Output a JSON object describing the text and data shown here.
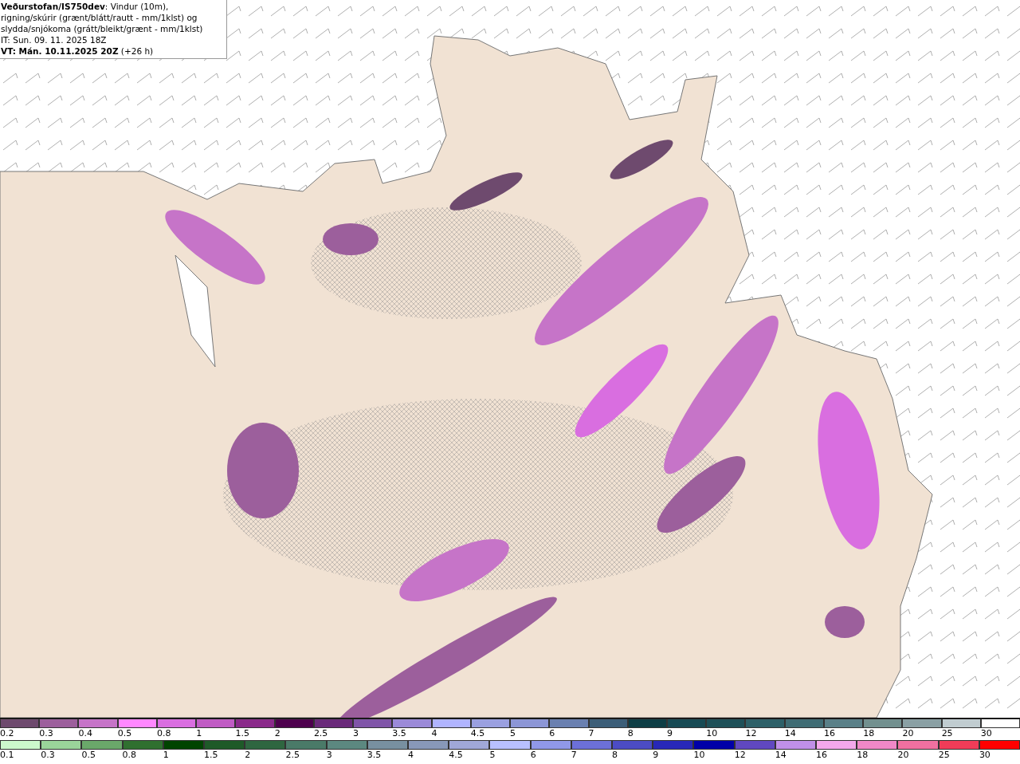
{
  "header": {
    "title": "**Veðurstofan/IS750dev**: Vindur (10m), rigning/skúrir (grænt/blátt/rautt - mm/1klst) og slydda/snjókoma (grátt/bleikt/grænt - mm/1klst)",
    "issue_time": "IT: Sun. 09. 11. 2025 18Z",
    "valid_time": "**VT: Mán. 10.11.2025 20Z** (+26 h)"
  },
  "legends": [
    {
      "items": [
        {
          "label": "0.2",
          "color": "#6e4a6e"
        },
        {
          "label": "0.3",
          "color": "#9c5f9c"
        },
        {
          "label": "0.4",
          "color": "#c674c8"
        },
        {
          "label": "0.5",
          "color": "#ff88ff"
        },
        {
          "label": "0.8",
          "color": "#d96ee0"
        },
        {
          "label": "1",
          "color": "#c05cc4"
        },
        {
          "label": "1.5",
          "color": "#8a2a8a"
        },
        {
          "label": "2",
          "color": "#4d004d"
        },
        {
          "label": "2.5",
          "color": "#6a2a7a"
        },
        {
          "label": "3",
          "color": "#8055a8"
        },
        {
          "label": "3.5",
          "color": "#9b8ad8"
        },
        {
          "label": "4",
          "color": "#b0b4ff"
        },
        {
          "label": "4.5",
          "color": "#9aa0e0"
        },
        {
          "label": "5",
          "color": "#8c96d6"
        },
        {
          "label": "6",
          "color": "#6a80b0"
        },
        {
          "label": "7",
          "color": "#3c5e78"
        },
        {
          "label": "8",
          "color": "#0d3d44"
        },
        {
          "label": "9",
          "color": "#174a54"
        },
        {
          "label": "10",
          "color": "#1e5058"
        },
        {
          "label": "12",
          "color": "#2d6068"
        },
        {
          "label": "14",
          "color": "#3f6c74"
        },
        {
          "label": "16",
          "color": "#5a8088"
        },
        {
          "label": "18",
          "color": "#72908f"
        },
        {
          "label": "20",
          "color": "#8aa0a4"
        },
        {
          "label": "25",
          "color": "#c0ccd0"
        },
        {
          "label": "30",
          "color": "#ffffff"
        }
      ]
    },
    {
      "items": [
        {
          "label": "0.1",
          "color": "#ccf8cc"
        },
        {
          "label": "0.3",
          "color": "#9ad49a"
        },
        {
          "label": "0.5",
          "color": "#6aa86a"
        },
        {
          "label": "0.8",
          "color": "#307030"
        },
        {
          "label": "1",
          "color": "#004400"
        },
        {
          "label": "1.5",
          "color": "#1e5a28"
        },
        {
          "label": "2",
          "color": "#2e6640"
        },
        {
          "label": "2.5",
          "color": "#4a7a68"
        },
        {
          "label": "3",
          "color": "#5c8880"
        },
        {
          "label": "3.5",
          "color": "#7890a0"
        },
        {
          "label": "4",
          "color": "#8898b8"
        },
        {
          "label": "4.5",
          "color": "#a0a8d8"
        },
        {
          "label": "5",
          "color": "#b8c0ff"
        },
        {
          "label": "6",
          "color": "#9098e8"
        },
        {
          "label": "7",
          "color": "#6c70d8"
        },
        {
          "label": "8",
          "color": "#4c4cc4"
        },
        {
          "label": "9",
          "color": "#2828b8"
        },
        {
          "label": "10",
          "color": "#0000a8"
        },
        {
          "label": "12",
          "color": "#6048c0"
        },
        {
          "label": "14",
          "color": "#c090e8"
        },
        {
          "label": "16",
          "color": "#f4a8ec"
        },
        {
          "label": "18",
          "color": "#f088c8"
        },
        {
          "label": "20",
          "color": "#f070a0"
        },
        {
          "label": "25",
          "color": "#f03c58"
        },
        {
          "label": "30",
          "color": "#ff0000"
        }
      ]
    }
  ]
}
